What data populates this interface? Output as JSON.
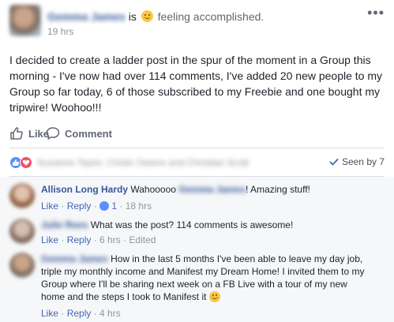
{
  "post": {
    "author": "Gemma James",
    "is_text": "is",
    "feeling": "feeling accomplished.",
    "timestamp": "19 hrs",
    "more_label": "•••",
    "body": "I decided to create a ladder post in the spur of the moment in a Group this morning - I've now had over 114 comments, I've added 20 new people to my Group so far today, 6 of those subscribed to my Freebie and one bought my tripwire! Woohoo!!!"
  },
  "actions": {
    "like_label": "Like",
    "comment_label": "Comment"
  },
  "reactions": {
    "names": "Suzanne Taylor, Cristin Owens and Christian Scott",
    "seen_by": "Seen by 7"
  },
  "comments": [
    {
      "author": "Allison Long Hardy",
      "text_before": "Wahooooo",
      "mention": "Gemma James",
      "text_after": "! Amazing stuff!",
      "like_label": "Like",
      "reply_label": "Reply",
      "like_count": "1",
      "time": "18 hrs"
    },
    {
      "author": "Julie Rees",
      "text": "What was the post? 114 comments is awesome!",
      "like_label": "Like",
      "reply_label": "Reply",
      "time": "6 hrs",
      "edited": "Edited"
    },
    {
      "author": "Gemma James",
      "line1": "How in the last 5 months I've been able to leave my day job,",
      "line2": "triple my monthly income and Manifest my Dream Home! I invited them to my",
      "line3": "Group where I'll be sharing next week on a FB Live with a tour of my new",
      "line4": "home and the steps I took to Manifest it",
      "like_label": "Like",
      "reply_label": "Reply",
      "time": "4 hrs"
    }
  ],
  "colors": {
    "link": "#365899",
    "like_blue": "#5890ff",
    "love_red": "#f25268",
    "comment_bg": "#f6f7f9"
  }
}
